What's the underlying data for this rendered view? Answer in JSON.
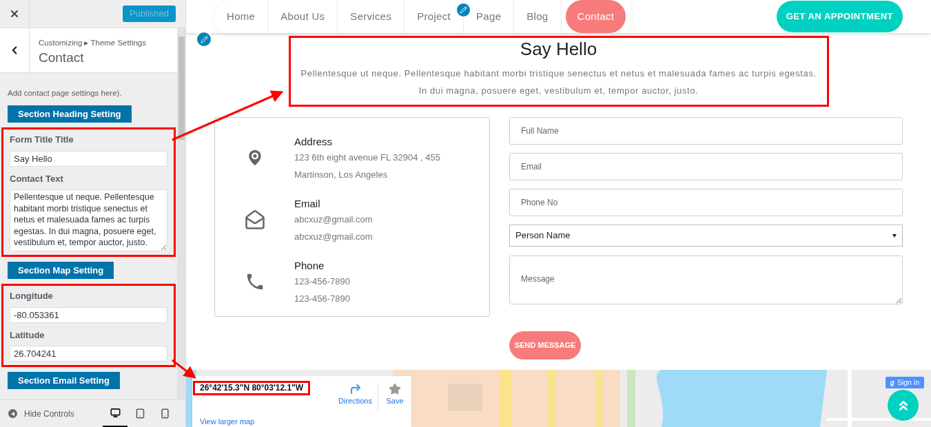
{
  "sidebar": {
    "published_button": {
      "label": "Published",
      "disabled": true
    },
    "breadcrumb": "Customizing ▸ Theme Settings",
    "title": "Contact",
    "description": "Add contact page settings here).",
    "groups": [
      {
        "framed": false,
        "items": [
          {
            "kind": "section_button",
            "label": "Section Heading Setting"
          }
        ]
      },
      {
        "framed": true,
        "items": [
          {
            "kind": "text_field",
            "label": "Form Title Title",
            "value": "Say Hello"
          },
          {
            "kind": "textarea",
            "label": "Contact Text",
            "value": "Pellentesque ut neque. Pellentesque habitant morbi tristique senectus et netus et malesuada fames ac turpis egestas. In dui magna, posuere eget, vestibulum et, tempor auctor, justo."
          }
        ]
      },
      {
        "framed": false,
        "items": [
          {
            "kind": "section_button",
            "label": "Section Map Setting"
          }
        ]
      },
      {
        "framed": true,
        "items": [
          {
            "kind": "text_field",
            "label": "Longitude",
            "value": "-80.053361"
          },
          {
            "kind": "text_field",
            "label": "Latitude",
            "value": "26.704241"
          }
        ]
      },
      {
        "framed": false,
        "items": [
          {
            "kind": "section_button",
            "label": "Section Email Setting"
          }
        ]
      }
    ],
    "hide_controls": "Hide Controls",
    "devices": [
      {
        "kind": "desktop",
        "selected": true
      },
      {
        "kind": "tablet",
        "selected": false
      },
      {
        "kind": "mobile",
        "selected": false
      }
    ]
  },
  "nav": {
    "items": [
      {
        "label": "Home",
        "selected": false
      },
      {
        "label": "About Us",
        "selected": false
      },
      {
        "label": "Services",
        "selected": false
      },
      {
        "label": "Project",
        "selected": false
      },
      {
        "label": "Page",
        "selected": false
      },
      {
        "label": "Blog",
        "selected": false
      },
      {
        "label": "Contact",
        "selected": true
      }
    ],
    "cta": "GET AN APPOINTMENT"
  },
  "heading": {
    "title": "Say Hello",
    "text": "Pellentesque ut neque. Pellentesque habitant morbi tristique senectus et netus et malesuada fames ac turpis egestas. In dui magna, posuere eget, vestibulum et, tempor auctor, justo.",
    "framed": true
  },
  "contact_info": [
    {
      "kind": "address",
      "title": "Address",
      "lines": [
        "123 6th eight avenue FL 32904 , 455",
        "Martinson, Los Angeles"
      ]
    },
    {
      "kind": "email",
      "title": "Email",
      "lines": [
        "abcxuz@gmail.com",
        "abcxuz@gmail.com"
      ]
    },
    {
      "kind": "phone",
      "title": "Phone",
      "lines": [
        "123-456-7890",
        "123-456-7890"
      ]
    }
  ],
  "form": {
    "fields": [
      {
        "kind": "input",
        "placeholder": "Full Name"
      },
      {
        "kind": "input",
        "placeholder": "Email"
      },
      {
        "kind": "input",
        "placeholder": "Phone No"
      },
      {
        "kind": "select",
        "value": "Person Name"
      },
      {
        "kind": "textarea",
        "placeholder": "Message"
      }
    ],
    "submit": "SEND MESSAGE"
  },
  "map": {
    "coordinates": "26°42'15.3\"N 80°03'12.1\"W",
    "directions": "Directions",
    "save": "Save",
    "larger_map": "View larger map",
    "sign_in_mark": "g",
    "sign_in": "Sign in"
  }
}
